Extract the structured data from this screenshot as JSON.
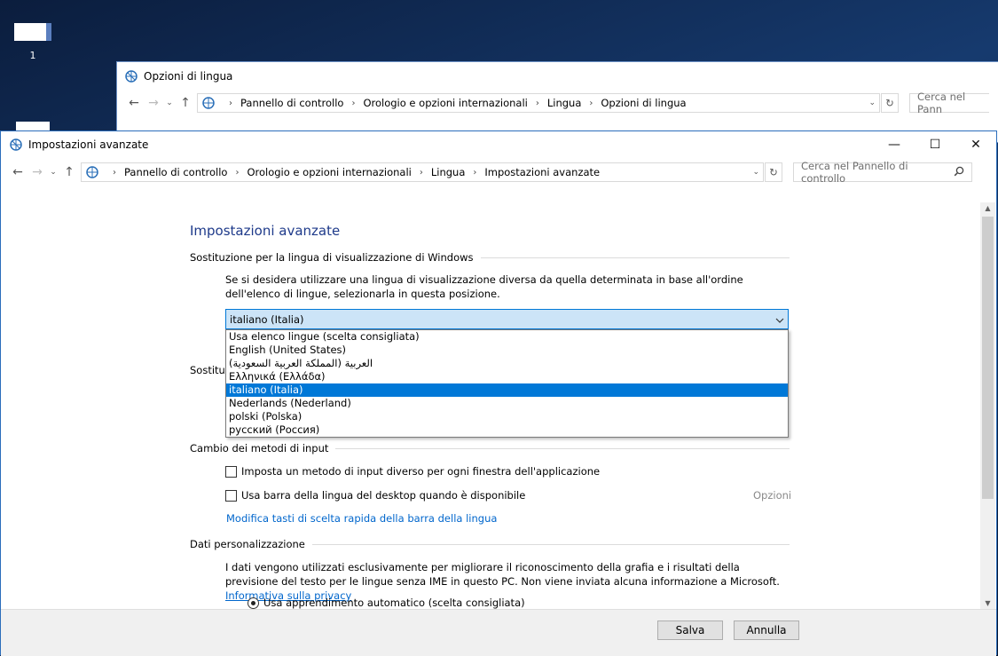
{
  "desktop": {
    "icon_label": "1"
  },
  "back_window": {
    "title": "Opzioni di lingua",
    "breadcrumbs": [
      "Pannello di controllo",
      "Orologio e opzioni internazionali",
      "Lingua",
      "Opzioni di lingua"
    ],
    "search_placeholder": "Cerca nel Pann"
  },
  "front_window": {
    "title": "Impostazioni avanzate",
    "breadcrumbs": [
      "Pannello di controllo",
      "Orologio e opzioni internazionali",
      "Lingua",
      "Impostazioni avanzate"
    ],
    "search_placeholder": "Cerca nel Pannello di controllo",
    "controls": {
      "minimize": "—",
      "maximize": "☐",
      "close": "✕"
    }
  },
  "content": {
    "heading": "Impostazioni avanzate",
    "override_display": {
      "title": "Sostituzione per la lingua di visualizzazione di Windows",
      "description": "Se si desidera utilizzare una lingua di visualizzazione diversa da quella determinata in base all'ordine dell'elenco di lingue, selezionarla in questa posizione.",
      "selected": "italiano (Italia)",
      "options": [
        "Usa elenco lingue (scelta consigliata)",
        "English (United States)",
        "العربية (المملكة العربية السعودية)",
        "Ελληνικά (Ελλάδα)",
        "italiano (Italia)",
        "Nederlands (Nederland)",
        "polski (Polska)",
        "русский (Россия)"
      ],
      "selected_index": 4
    },
    "hidden_section_fragment": "Sostituz",
    "input_methods": {
      "title": "Cambio dei metodi di input",
      "checkbox1": "Imposta un metodo di input diverso per ogni finestra dell'applicazione",
      "checkbox2": "Usa barra della lingua del desktop quando è disponibile",
      "options_link": "Opzioni",
      "hotkeys_link": "Modifica tasti di scelta rapida della barra della lingua"
    },
    "personalization": {
      "title": "Dati personalizzazione",
      "text": "I dati vengono utilizzati esclusivamente per migliorare il riconoscimento della grafia e i risultati della previsione del testo per le lingue senza IME in questo PC. Non viene inviata alcuna informazione a Microsoft.",
      "privacy_link": "Informativa sulla privacy",
      "radio1": "Usa apprendimento automatico (scelta consigliata)"
    }
  },
  "footer": {
    "save": "Salva",
    "cancel": "Annulla"
  },
  "colors": {
    "accent": "#0078d7",
    "link": "#0066cc",
    "heading": "#1e3a8a"
  }
}
